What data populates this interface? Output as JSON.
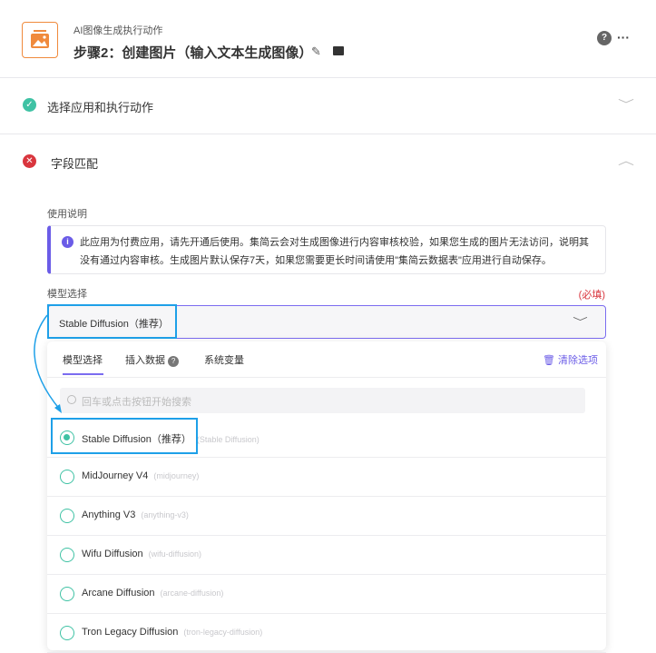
{
  "header": {
    "subtitle": "AI图像生成执行动作",
    "title": "步骤2：创建图片（输入文本生成图像）"
  },
  "sections": [
    {
      "label": "选择应用和执行动作",
      "status": "success"
    },
    {
      "label": "字段匹配",
      "status": "error"
    }
  ],
  "usage": {
    "label": "使用说明",
    "text": "此应用为付费应用，请先开通后使用。集简云会对生成图像进行内容审核校验，如果您生成的图片无法访问，说明其没有通过内容审核。生成图片默认保存7天，如果您需要更长时间请使用\"集简云数据表\"应用进行自动保存。"
  },
  "model": {
    "label": "模型选择",
    "required": "(必填)",
    "value": "Stable Diffusion（推荐）"
  },
  "dropdown": {
    "tabs": [
      "模型选择",
      "插入数据",
      "系统变量"
    ],
    "clear": "清除选项",
    "search_placeholder": "回车或点击按钮开始搜索",
    "options": [
      {
        "label": "Stable Diffusion（推荐）",
        "sub": "(Stable Diffusion)",
        "selected": true
      },
      {
        "label": "MidJourney V4",
        "sub": "(midjourney)"
      },
      {
        "label": "Anything V3",
        "sub": "(anything-v3)"
      },
      {
        "label": "Wifu Diffusion",
        "sub": "(wifu-diffusion)"
      },
      {
        "label": "Arcane Diffusion",
        "sub": "(arcane-diffusion)"
      },
      {
        "label": "Tron Legacy Diffusion",
        "sub": "(tron-legacy-diffusion)"
      }
    ]
  },
  "colors": {
    "accent": "#6b5ce7",
    "highlight": "#1ea0e8",
    "success": "#3fc2a4",
    "error": "#d9363e",
    "brand": "#f08a3c"
  }
}
